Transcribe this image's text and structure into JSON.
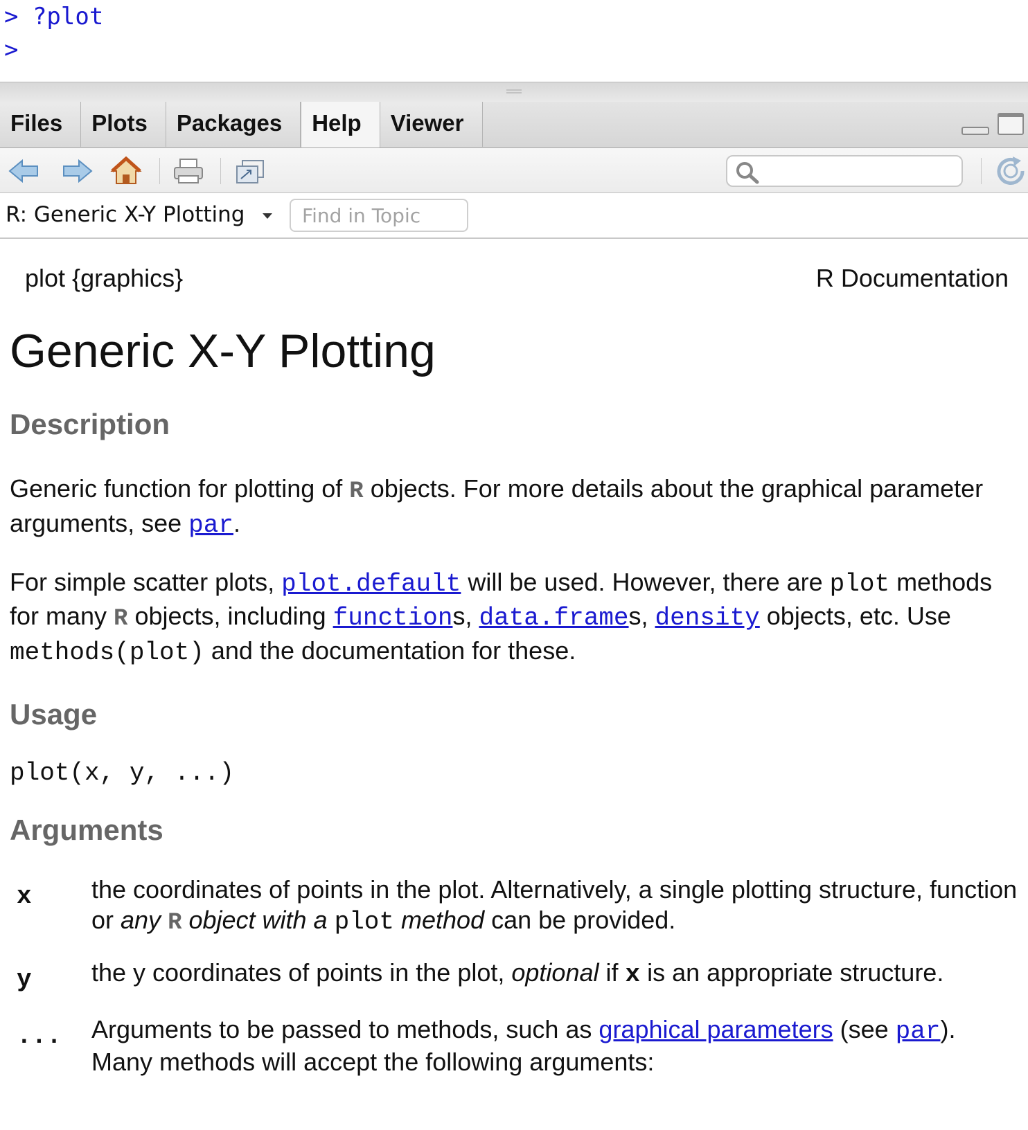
{
  "console": {
    "lines": [
      "> ?plot",
      ">"
    ]
  },
  "tabs": [
    "Files",
    "Plots",
    "Packages",
    "Help",
    "Viewer"
  ],
  "active_tab": "Help",
  "topic": {
    "title": "R: Generic X-Y Plotting",
    "find_placeholder": "Find in Topic"
  },
  "doc": {
    "header_left": "plot {graphics}",
    "header_right": "R Documentation",
    "title": "Generic X-Y Plotting",
    "description_heading": "Description",
    "desc_p1": {
      "t1": "Generic function for plotting of ",
      "r": "R",
      "t2": " objects. For more details about the graphical parameter arguments, see ",
      "link_par": "par",
      "t3": "."
    },
    "desc_p2": {
      "t1": "For simple scatter plots, ",
      "link_plot_default": "plot.default",
      "t2": " will be used. However, there are ",
      "code_plot": "plot",
      "t3": " methods for many ",
      "r": "R",
      "t4": " objects, including ",
      "link_function": "function",
      "t5": "s, ",
      "link_data_frame": "data.frame",
      "t6": "s, ",
      "link_density": "density",
      "t7": " objects, etc. Use ",
      "code_methods": "methods(plot)",
      "t8": " and the documentation for these."
    },
    "usage_heading": "Usage",
    "usage_code": "plot(x, y, ...)",
    "arguments_heading": "Arguments",
    "args": {
      "x": {
        "name": "x",
        "t1": "the coordinates of points in the plot. Alternatively, a single plotting structure, function or ",
        "em1": "any ",
        "r": "R",
        "em2": " object with a ",
        "code": "plot",
        "em3": " method",
        "t2": " can be provided."
      },
      "y": {
        "name": "y",
        "t1": "the y coordinates of points in the plot, ",
        "em": "optional",
        "t2": " if ",
        "code": "x",
        "t3": " is an appropriate structure."
      },
      "dots": {
        "name": "...",
        "t1": "Arguments to be passed to methods, such as ",
        "link_gp": "graphical parameters",
        "t2": " (see ",
        "link_par": "par",
        "t3": "). Many methods will accept the following arguments:"
      }
    }
  }
}
